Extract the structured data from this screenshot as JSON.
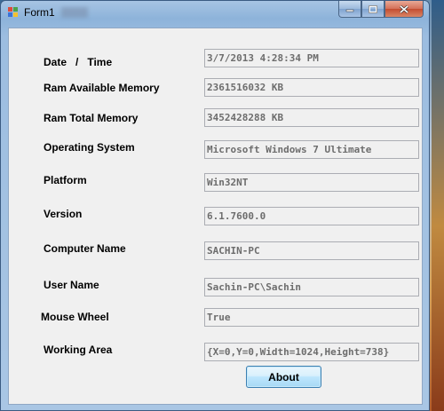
{
  "window": {
    "title": "Form1",
    "buttons": {
      "minimize_icon": "minimize-icon",
      "maximize_icon": "maximize-icon",
      "close_icon": "close-icon"
    }
  },
  "fields": [
    {
      "label": "Date   /   Time",
      "value": "3/7/2013 4:28:34 PM"
    },
    {
      "label": "Ram Available Memory",
      "value": "2361516032 KB"
    },
    {
      "label": "Ram Total Memory",
      "value": "3452428288 KB"
    },
    {
      "label": "Operating System",
      "value": "Microsoft Windows 7 Ultimate"
    },
    {
      "label": "Platform",
      "value": "Win32NT"
    },
    {
      "label": "Version",
      "value": "6.1.7600.0"
    },
    {
      "label": "Computer Name",
      "value": "SACHIN-PC"
    },
    {
      "label": "User Name",
      "value": "Sachin-PC\\Sachin"
    },
    {
      "label": "Mouse Wheel",
      "value": "True"
    },
    {
      "label": "Working Area",
      "value": "{X=0,Y=0,Width=1024,Height=738}"
    }
  ],
  "about_button": "About",
  "colors": {
    "client_bg": "#f0f0f0",
    "field_text": "#6d6d6d",
    "window_frame": "#9cbde0"
  }
}
